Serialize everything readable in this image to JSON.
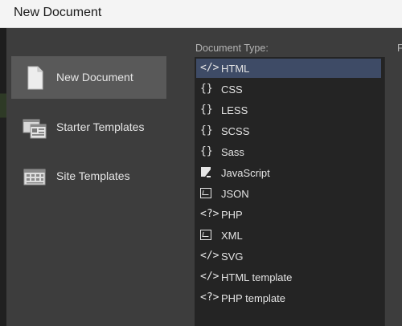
{
  "window": {
    "title": "New Document"
  },
  "nav": {
    "items": [
      {
        "label": "New Document",
        "icon": "blank-document-icon",
        "selected": true
      },
      {
        "label": "Starter Templates",
        "icon": "starter-templates-icon",
        "selected": false
      },
      {
        "label": "Site Templates",
        "icon": "site-templates-icon",
        "selected": false
      }
    ]
  },
  "document_type": {
    "heading": "Document Type:",
    "items": [
      {
        "label": "HTML",
        "icon": "</>",
        "selected": true
      },
      {
        "label": "CSS",
        "icon": "{}"
      },
      {
        "label": "LESS",
        "icon": "{}"
      },
      {
        "label": "SCSS",
        "icon": "{}"
      },
      {
        "label": "Sass",
        "icon": "{}"
      },
      {
        "label": "JavaScript",
        "icon": "javascript-icon"
      },
      {
        "label": "JSON",
        "icon": "json-icon"
      },
      {
        "label": "PHP",
        "icon": "<?>"
      },
      {
        "label": "XML",
        "icon": "xml-icon"
      },
      {
        "label": "SVG",
        "icon": "</>"
      },
      {
        "label": "HTML template",
        "icon": "</>"
      },
      {
        "label": "PHP template",
        "icon": "<?>"
      }
    ]
  },
  "right_panel": {
    "heading_partial": "F"
  },
  "colors": {
    "selected_row": "#3e4b66",
    "selected_nav": "#595959",
    "list_bg": "#242424",
    "dialog_bg": "#3d3d3d"
  }
}
